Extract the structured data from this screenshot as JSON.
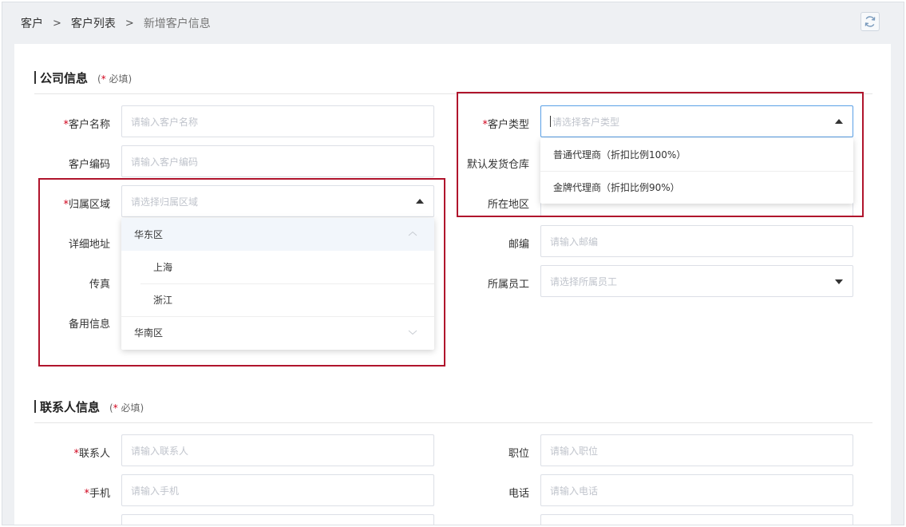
{
  "breadcrumb": {
    "items": [
      "客户",
      "客户列表",
      "新增客户信息"
    ],
    "separator": ">"
  },
  "refresh_icon": "refresh-icon",
  "company_section": {
    "title": "公司信息",
    "required_star": "*",
    "required_text": " 必填)",
    "required_open": "("
  },
  "contact_section": {
    "title": "联系人信息",
    "required_star": "*",
    "required_text": " 必填)",
    "required_open": "("
  },
  "fields": {
    "customer_name": {
      "label": "客户名称",
      "placeholder": "请输入客户名称",
      "required": "*"
    },
    "customer_code": {
      "label": "客户编码",
      "placeholder": "请输入客户编码"
    },
    "region": {
      "label": "归属区域",
      "placeholder": "请选择归属区域",
      "required": "*"
    },
    "address": {
      "label": "详细地址"
    },
    "fax": {
      "label": "传真"
    },
    "remark": {
      "label": "备用信息"
    },
    "customer_type": {
      "label": "客户类型",
      "placeholder": "请选择客户类型",
      "required": "*"
    },
    "warehouse": {
      "label": "默认发货仓库"
    },
    "location": {
      "label": "所在地区"
    },
    "postcode": {
      "label": "邮编",
      "placeholder": "请输入邮编"
    },
    "employee": {
      "label": "所属员工",
      "placeholder": "请选择所属员工"
    },
    "contact": {
      "label": "联系人",
      "placeholder": "请输入联系人",
      "required": "*"
    },
    "mobile": {
      "label": "手机",
      "placeholder": "请输入手机",
      "required": "*"
    },
    "position": {
      "label": "职位",
      "placeholder": "请输入职位"
    },
    "phone": {
      "label": "电话",
      "placeholder": "请输入电话"
    }
  },
  "region_dropdown": {
    "groups": [
      {
        "label": "华东区",
        "expanded": true,
        "children": [
          "上海",
          "浙江"
        ]
      },
      {
        "label": "华南区",
        "expanded": false,
        "children": []
      }
    ]
  },
  "type_dropdown": {
    "options": [
      "普通代理商（折扣比例100%）",
      "金牌代理商（折扣比例90%）"
    ]
  },
  "colors": {
    "required_star": "#d0021b",
    "highlight_box": "#b0142c",
    "focus_border": "#5aa0e6"
  }
}
